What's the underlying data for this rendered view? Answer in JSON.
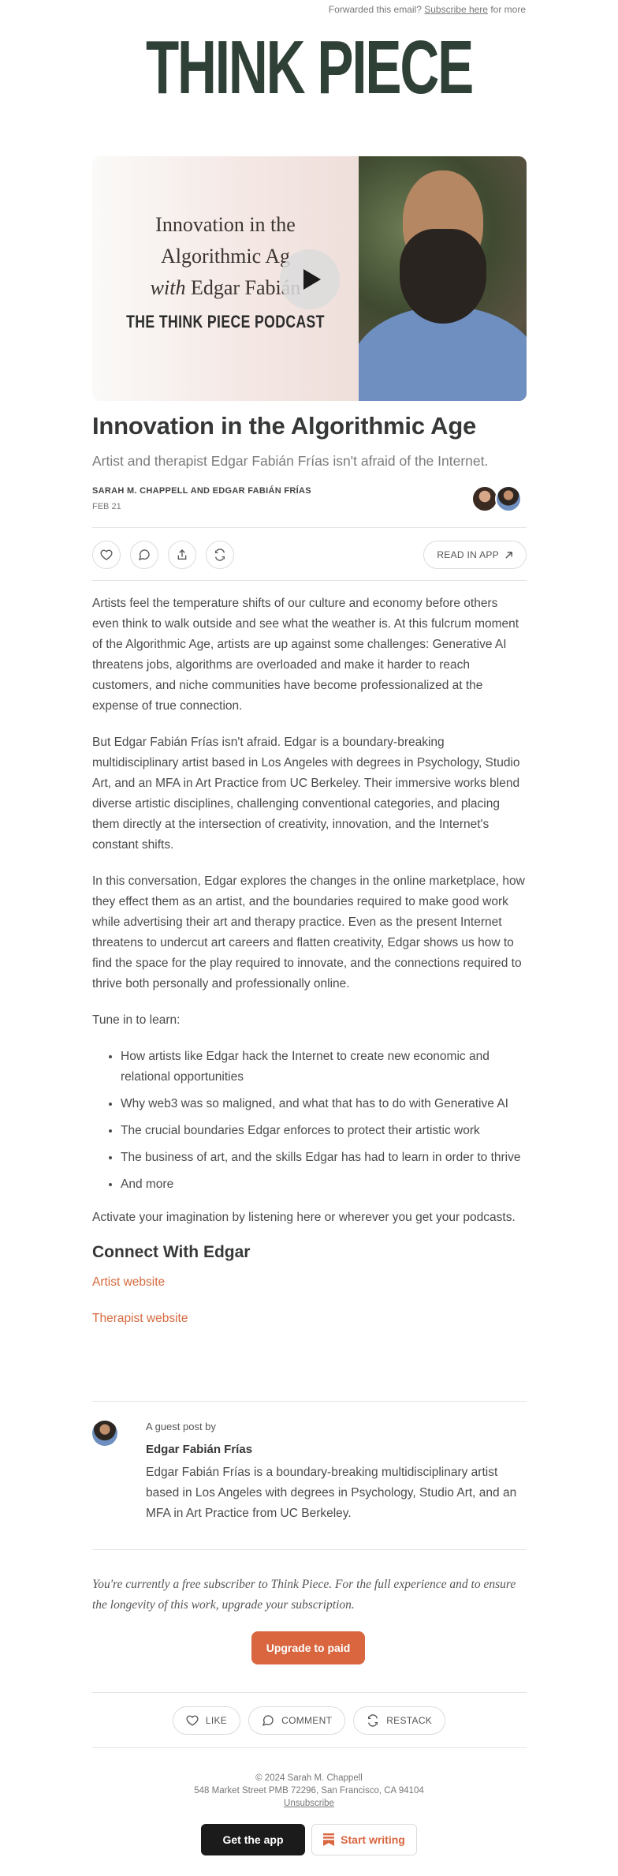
{
  "header": {
    "forwarded_prefix": "Forwarded this email?",
    "subscribe_link": "Subscribe here",
    "forwarded_suffix": "for more",
    "logo": "THINK PIECE"
  },
  "hero": {
    "line1": "Innovation in the",
    "line2": "Algorithmic Ag",
    "line3_em": "with",
    "line3_rest": "Edgar Fabián",
    "podcast": "THE THINK PIECE PODCAST",
    "play_icon": "play-icon"
  },
  "post": {
    "title": "Innovation in the Algorithmic Age",
    "subtitle": "Artist and therapist Edgar Fabián Frías isn't afraid of the Internet.",
    "byline": "SARAH M. CHAPPELL AND EDGAR FABIÁN FRÍAS",
    "date": "FEB 21"
  },
  "actions": {
    "read_in_app": "READ IN APP"
  },
  "body": {
    "p1": "Artists feel the temperature shifts of our culture and economy before others even think to walk outside and see what the weather is. At this fulcrum moment of the Algorithmic Age, artists are up against some challenges: Generative AI threatens jobs, algorithms are overloaded and make it harder to reach customers, and niche communities have become professionalized at the expense of true connection.",
    "p2": "But Edgar Fabián Frías isn't afraid. Edgar is a boundary-breaking multidisciplinary artist based in Los Angeles with degrees in Psychology, Studio Art, and an MFA in Art Practice from UC Berkeley. Their immersive works blend diverse artistic disciplines, challenging conventional categories, and placing them directly at the intersection of creativity, innovation, and the Internet's constant shifts.",
    "p3": "In this conversation, Edgar explores the changes in the online marketplace, how they effect them as an artist, and the boundaries required to make good work while advertising their art and therapy practice. Even as the present Internet threatens to undercut art careers and flatten creativity, Edgar shows us how to find the space for the play required to innovate, and the connections required to thrive both personally and professionally online.",
    "p4": "Tune in to learn:",
    "bullets": [
      "How artists like Edgar hack the Internet to create new economic and relational opportunities",
      "Why web3 was so maligned, and what that has to do with Generative AI",
      "The crucial boundaries Edgar enforces to protect their artistic work",
      "The business of art, and the skills Edgar has had to learn in order to thrive",
      "And more"
    ],
    "p5": "Activate your imagination by listening here or wherever you get your podcasts.",
    "connect_heading": "Connect With Edgar",
    "link1": "Artist website",
    "link2": "Therapist website"
  },
  "guest": {
    "label": "A guest post by",
    "name": "Edgar Fabián Frías",
    "bio": "Edgar Fabián Frías is a boundary-breaking multidisciplinary artist based in Los Angeles with degrees in Psychology, Studio Art, and an MFA in Art Practice from UC Berkeley."
  },
  "subscription": {
    "note": "You're currently a free subscriber to Think Piece. For the full experience and to ensure the longevity of this work, upgrade your subscription.",
    "upgrade": "Upgrade to paid"
  },
  "bottom_actions": {
    "like": "LIKE",
    "comment": "COMMENT",
    "restack": "RESTACK"
  },
  "footer": {
    "copyright": "© 2024 Sarah M. Chappell",
    "address": "548 Market Street PMB 72296, San Francisco, CA 94104",
    "unsubscribe": "Unsubscribe",
    "get_app": "Get the app",
    "start_writing": "Start writing"
  },
  "colors": {
    "accent": "#d9663f",
    "logo": "#2f4037",
    "text": "#363737"
  }
}
